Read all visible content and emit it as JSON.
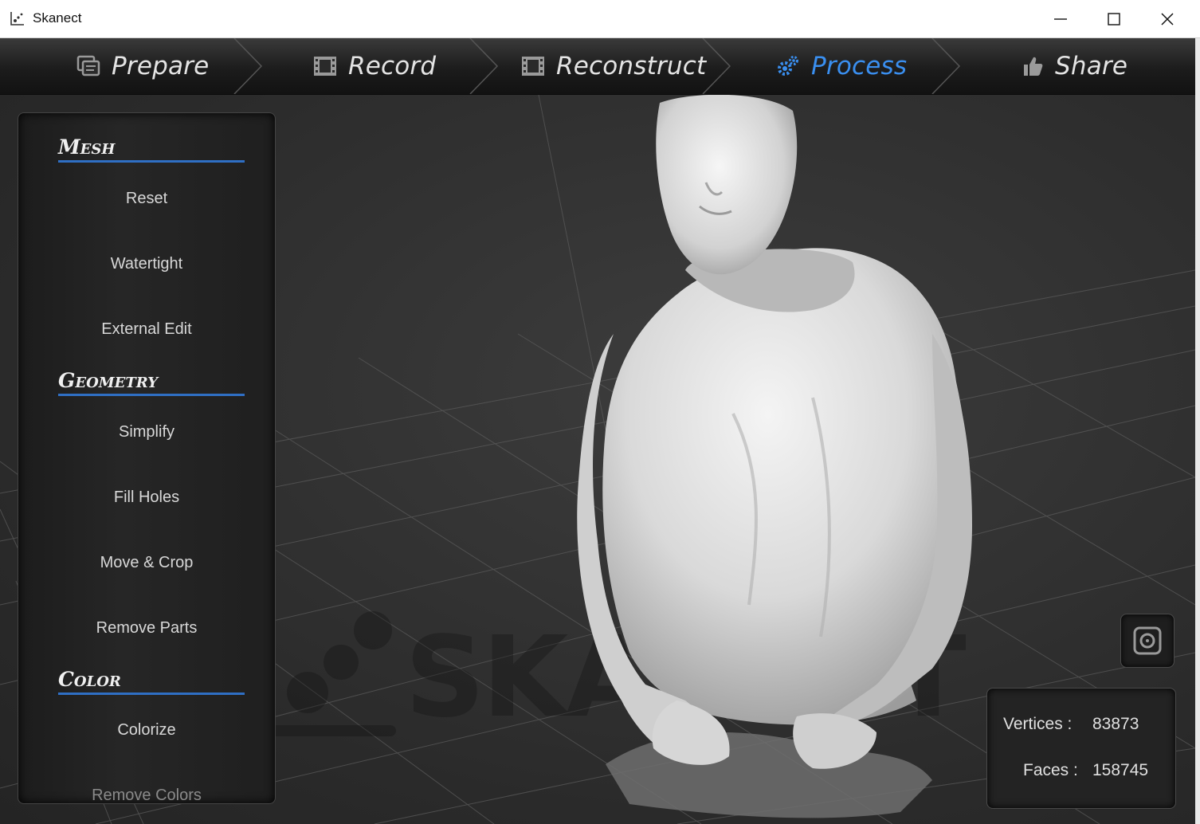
{
  "window": {
    "title": "Skanect"
  },
  "tabs": [
    {
      "label": "Prepare",
      "icon": "prepare-icon",
      "active": false
    },
    {
      "label": "Record",
      "icon": "film-icon",
      "active": false
    },
    {
      "label": "Reconstruct",
      "icon": "film-icon",
      "active": false
    },
    {
      "label": "Process",
      "icon": "gears-icon",
      "active": true
    },
    {
      "label": "Share",
      "icon": "thumbs-up-icon",
      "active": false
    }
  ],
  "colors": {
    "accent": "#3a8ff0",
    "section_underline": "#2f6fc4"
  },
  "panel": {
    "mesh": {
      "heading": "Mesh",
      "items": [
        "Reset",
        "Watertight",
        "External Edit"
      ]
    },
    "geometry": {
      "heading": "Geometry",
      "items": [
        "Simplify",
        "Fill Holes",
        "Move & Crop",
        "Remove Parts"
      ]
    },
    "color": {
      "heading": "Color",
      "items": [
        "Colorize",
        "Remove Colors"
      ]
    }
  },
  "stats": {
    "vertices_label": "Vertices :",
    "vertices_value": "83873",
    "faces_label": "Faces :",
    "faces_value": "158745"
  },
  "watermark": {
    "text": "SKANECT"
  }
}
